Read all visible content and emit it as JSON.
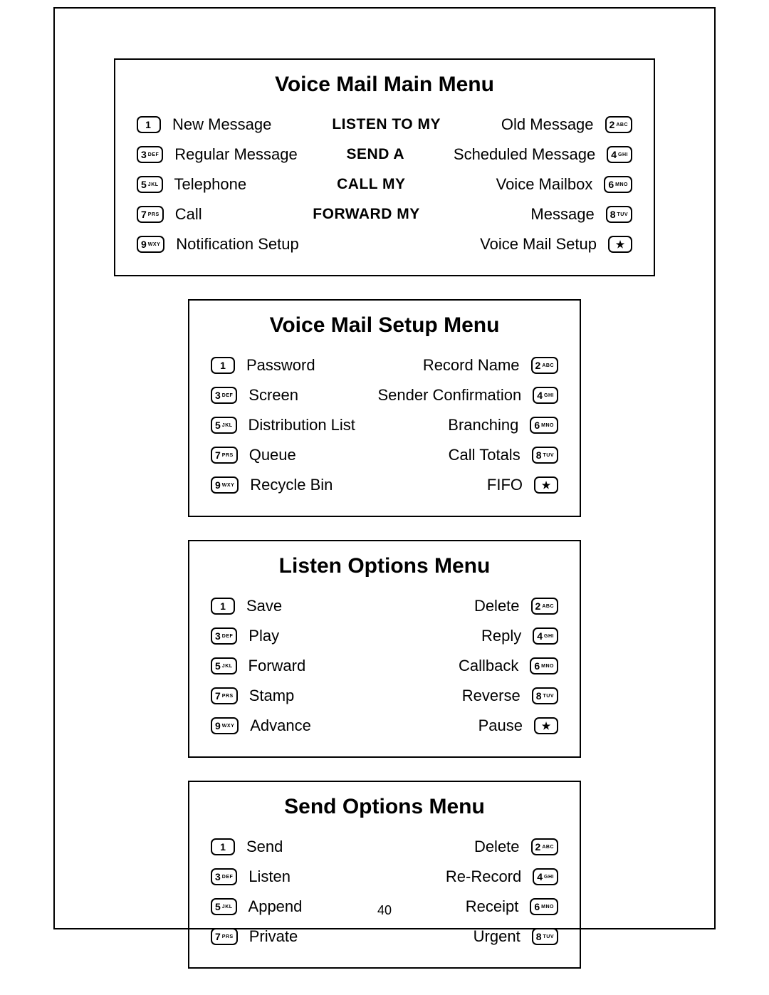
{
  "pageNumber": "40",
  "keys": {
    "1": {
      "d": "1",
      "l": ""
    },
    "2": {
      "d": "2",
      "l": "ABC"
    },
    "3": {
      "d": "3",
      "l": "DEF"
    },
    "4": {
      "d": "4",
      "l": "GHI"
    },
    "5": {
      "d": "5",
      "l": "JKL"
    },
    "6": {
      "d": "6",
      "l": "MNO"
    },
    "7": {
      "d": "7",
      "l": "PRS"
    },
    "8": {
      "d": "8",
      "l": "TUV"
    },
    "9": {
      "d": "9",
      "l": "WXY"
    },
    "star": {
      "d": "★",
      "l": ""
    }
  },
  "mainMenu": {
    "title": "Voice Mail Main Menu",
    "rows": [
      {
        "lk": "1",
        "ll": "New Message",
        "c": "LISTEN TO MY",
        "rl": "Old Message",
        "rk": "2"
      },
      {
        "lk": "3",
        "ll": "Regular Message",
        "c": "SEND A",
        "rl": "Scheduled Message",
        "rk": "4"
      },
      {
        "lk": "5",
        "ll": "Telephone",
        "c": "CALL MY",
        "rl": "Voice Mailbox",
        "rk": "6"
      },
      {
        "lk": "7",
        "ll": "Call",
        "c": "FORWARD MY",
        "rl": "Message",
        "rk": "8"
      },
      {
        "lk": "9",
        "ll": "Notification Setup",
        "c": "",
        "rl": "Voice Mail Setup",
        "rk": "star"
      }
    ]
  },
  "setupMenu": {
    "title": "Voice Mail Setup Menu",
    "rows": [
      {
        "lk": "1",
        "ll": "Password",
        "rl": "Record Name",
        "rk": "2"
      },
      {
        "lk": "3",
        "ll": "Screen",
        "rl": "Sender Confirmation",
        "rk": "4"
      },
      {
        "lk": "5",
        "ll": "Distribution List",
        "rl": "Branching",
        "rk": "6"
      },
      {
        "lk": "7",
        "ll": "Queue",
        "rl": "Call Totals",
        "rk": "8"
      },
      {
        "lk": "9",
        "ll": "Recycle Bin",
        "rl": "FIFO",
        "rk": "star"
      }
    ]
  },
  "listenMenu": {
    "title": "Listen Options Menu",
    "rows": [
      {
        "lk": "1",
        "ll": "Save",
        "rl": "Delete",
        "rk": "2"
      },
      {
        "lk": "3",
        "ll": "Play",
        "rl": "Reply",
        "rk": "4"
      },
      {
        "lk": "5",
        "ll": "Forward",
        "rl": "Callback",
        "rk": "6"
      },
      {
        "lk": "7",
        "ll": "Stamp",
        "rl": "Reverse",
        "rk": "8"
      },
      {
        "lk": "9",
        "ll": "Advance",
        "rl": "Pause",
        "rk": "star"
      }
    ]
  },
  "sendMenu": {
    "title": "Send Options Menu",
    "rows": [
      {
        "lk": "1",
        "ll": "Send",
        "rl": "Delete",
        "rk": "2"
      },
      {
        "lk": "3",
        "ll": "Listen",
        "rl": "Re-Record",
        "rk": "4"
      },
      {
        "lk": "5",
        "ll": "Append",
        "rl": "Receipt",
        "rk": "6"
      },
      {
        "lk": "7",
        "ll": "Private",
        "rl": "Urgent",
        "rk": "8"
      }
    ]
  }
}
